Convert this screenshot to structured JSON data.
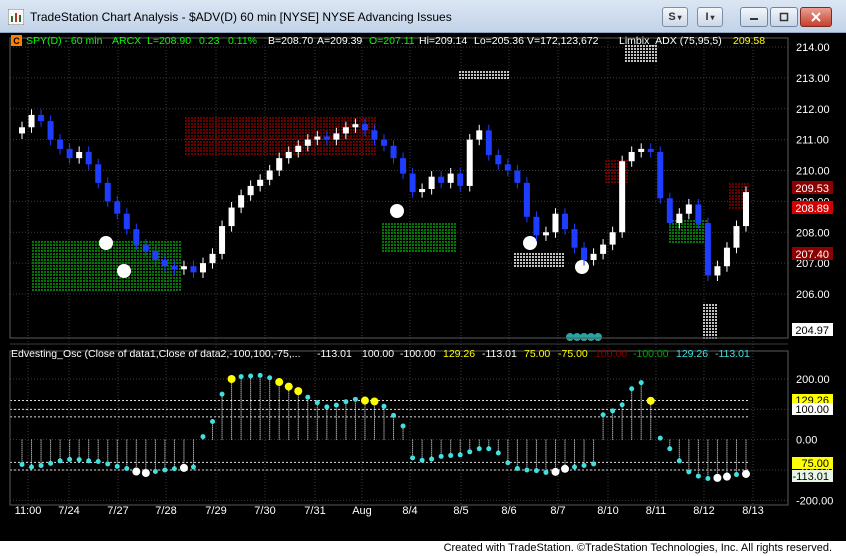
{
  "window": {
    "title": "TradeStation Chart Analysis - $ADV(D) 60 min [NYSE] NYSE Advancing Issues",
    "menu_s": "S",
    "menu_i": "I",
    "menu_arrow": "▾"
  },
  "price_header": {
    "symbol": "SPY(D) - 60 min",
    "exchange": "ARCX",
    "last": "L=208.90",
    "change": "0.23",
    "change_pct": "0.11%",
    "bid": "B=208.70",
    "ask": "A=209.39",
    "open": "O=207.11",
    "high": "Hi=209.14",
    "low": "Lo=205.36",
    "volume": "V=172,123,672",
    "indicator_name": "Limbix_ADX (75,95,5)",
    "indicator_value": "209.58",
    "flag": "C"
  },
  "osc_header": {
    "name": "Edvesting_Osc (Close of data1,Close of data2,-100,100,-75,...",
    "values": [
      {
        "text": "-113.01",
        "color": "#ffffff"
      },
      {
        "text": "100.00",
        "color": "#ffffff"
      },
      {
        "text": "-100.00",
        "color": "#ffffff"
      },
      {
        "text": "129.26",
        "color": "#ffff00"
      },
      {
        "text": "-113.01",
        "color": "#ffffff"
      },
      {
        "text": "75.00",
        "color": "#ffff00"
      },
      {
        "text": "-75.00",
        "color": "#ffff00"
      },
      {
        "text": "100.00",
        "color": "#8b0000"
      },
      {
        "text": "-100.00",
        "color": "#00aa00"
      },
      {
        "text": "129.26",
        "color": "#40e0e0"
      },
      {
        "text": "-113.01",
        "color": "#40e0e0"
      }
    ]
  },
  "price_axis": {
    "ticks": [
      "214.00",
      "213.00",
      "212.00",
      "211.00",
      "210.00",
      "209.00",
      "208.00",
      "207.00",
      "206.00"
    ],
    "markers": [
      {
        "text": "209.53",
        "bg": "#8b0000",
        "fg": "#ffffff"
      },
      {
        "text": "208.89",
        "bg": "#d40000",
        "fg": "#ffffff"
      },
      {
        "text": "207.40",
        "bg": "#8b0000",
        "fg": "#ffffff"
      },
      {
        "text": "204.97",
        "bg": "#ffffff",
        "fg": "#000000"
      }
    ]
  },
  "osc_axis": {
    "ticks": [
      "200.00",
      "100.00",
      "0.00",
      "-100.00",
      "-200.00"
    ],
    "markers": [
      {
        "text": "129.26",
        "bg": "#ffff00",
        "fg": "#000000"
      },
      {
        "text": "100.00",
        "bg": "#ffffff",
        "fg": "#000000"
      },
      {
        "text": "75.00",
        "bg": "#ffff00",
        "fg": "#000000"
      },
      {
        "text": "-113.01",
        "bg": "#e6f5e6",
        "fg": "#000000"
      }
    ]
  },
  "time_axis": [
    "11:00",
    "7/24",
    "7/27",
    "7/28",
    "7/29",
    "7/30",
    "7/31",
    "Aug",
    "8/4",
    "8/5",
    "8/6",
    "8/7",
    "8/10",
    "8/11",
    "8/12",
    "8/13"
  ],
  "footer": "Created with TradeStation. ©TradeStation Technologies, Inc. All rights reserved.",
  "colors": {
    "bull": "#ffffff",
    "bear": "#1f3dff",
    "red_dots": "#8b0000",
    "green_dots": "#00a000",
    "osc_dot": "#40e0e0",
    "osc_yellow": "#ffff00"
  },
  "chart_data": {
    "type": "candlestick",
    "price_ylim": [
      204.5,
      214.3
    ],
    "osc_ylim": [
      -230,
      240
    ],
    "closes": [
      211.4,
      211.8,
      211.6,
      211.0,
      210.7,
      210.4,
      210.6,
      210.2,
      209.6,
      209.0,
      208.6,
      208.1,
      207.6,
      207.4,
      207.1,
      206.9,
      206.8,
      206.9,
      206.7,
      207.0,
      207.3,
      208.2,
      208.8,
      209.2,
      209.5,
      209.7,
      210.0,
      210.4,
      210.6,
      210.8,
      211.0,
      211.1,
      211.0,
      211.2,
      211.4,
      211.5,
      211.3,
      211.0,
      210.8,
      210.4,
      209.9,
      209.3,
      209.4,
      209.8,
      209.6,
      209.9,
      209.5,
      211.0,
      211.3,
      210.5,
      210.2,
      210.0,
      209.6,
      208.5,
      207.9,
      208.0,
      208.6,
      208.1,
      207.5,
      207.1,
      207.3,
      207.6,
      208.0,
      210.3,
      210.6,
      210.7,
      210.6,
      209.1,
      208.3,
      208.6,
      208.9,
      208.3,
      206.6,
      206.9,
      207.5,
      208.2,
      209.3
    ],
    "oscillator": [
      -82,
      -90,
      -85,
      -78,
      -70,
      -65,
      -66,
      -70,
      -72,
      -80,
      -88,
      -95,
      -105,
      -110,
      -105,
      -100,
      -96,
      -93,
      -90,
      10,
      60,
      150,
      200,
      208,
      210,
      212,
      204,
      190,
      175,
      160,
      140,
      122,
      108,
      114,
      125,
      133,
      129,
      126,
      110,
      80,
      45,
      -60,
      -68,
      -64,
      -55,
      -52,
      -50,
      -40,
      -30,
      -30,
      -44,
      -76,
      -95,
      -100,
      -102,
      -108,
      -106,
      -96,
      -90,
      -85,
      -80,
      82,
      95,
      115,
      168,
      188,
      128,
      5,
      -30,
      -70,
      -106,
      -120,
      -128,
      -126,
      -122,
      -115,
      -113
    ],
    "oscillator_highlights": [
      {
        "index": 12,
        "color": "white"
      },
      {
        "index": 13,
        "color": "white"
      },
      {
        "index": 17,
        "color": "white"
      },
      {
        "index": 22,
        "color": "yellow"
      },
      {
        "index": 27,
        "color": "yellow"
      },
      {
        "index": 28,
        "color": "yellow"
      },
      {
        "index": 29,
        "color": "yellow"
      },
      {
        "index": 36,
        "color": "yellow"
      },
      {
        "index": 37,
        "color": "yellow"
      },
      {
        "index": 56,
        "color": "white"
      },
      {
        "index": 57,
        "color": "white"
      },
      {
        "index": 66,
        "color": "yellow"
      },
      {
        "index": 73,
        "color": "white"
      },
      {
        "index": 74,
        "color": "white"
      },
      {
        "index": 76,
        "color": "white"
      }
    ],
    "osc_levels": [
      129.26,
      100,
      75,
      0,
      -75,
      -100,
      -113.01
    ]
  }
}
